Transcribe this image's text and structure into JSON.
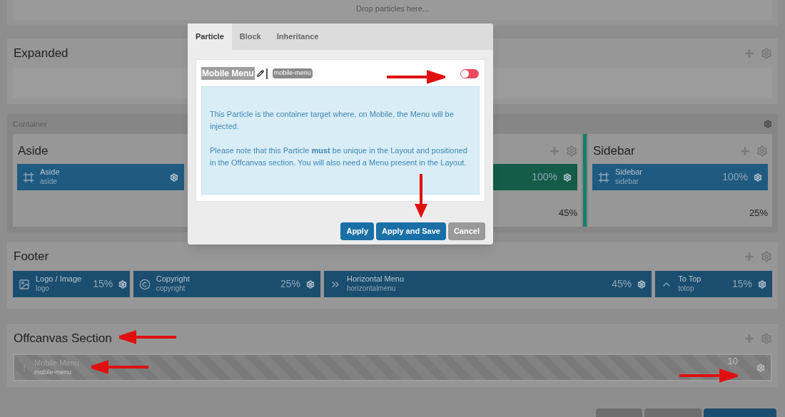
{
  "drop_zone": {
    "text": "Drop particles here..."
  },
  "expanded": {
    "title": "Expanded"
  },
  "container": {
    "label": "Container",
    "columns": [
      {
        "title": "Aside",
        "particle": {
          "title": "Aside",
          "subtitle": "aside",
          "color": "#1f5a80"
        }
      },
      {
        "size": "45%",
        "particle": {
          "size": "100%",
          "color": "#145c48"
        }
      },
      {
        "title": "Sidebar",
        "size": "25%",
        "particle": {
          "title": "Sidebar",
          "subtitle": "sidebar",
          "size": "100%",
          "color": "#1f5a80"
        }
      }
    ]
  },
  "footer": {
    "title": "Footer",
    "particles": [
      {
        "kind": "image",
        "title": "Logo / Image",
        "subtitle": "logo",
        "size": "15%"
      },
      {
        "kind": "copyright",
        "title": "Copyright",
        "subtitle": "copyright",
        "size": "25%"
      },
      {
        "kind": "menu",
        "title": "Horizontal Menu",
        "subtitle": "horizontalmenu",
        "size": "45%"
      },
      {
        "kind": "totop",
        "title": "To Top",
        "subtitle": "totop",
        "size": "15%"
      }
    ]
  },
  "offcanvas": {
    "title": "Offcanvas Section",
    "particle": {
      "title": "Mobile Menu",
      "subtitle": "mobile-menu",
      "size": "10",
      "disabled": true
    }
  },
  "modal": {
    "tabs": [
      {
        "label": "Particle",
        "selected": true
      },
      {
        "label": "Block",
        "selected": false
      },
      {
        "label": "Inheritance",
        "selected": false
      }
    ],
    "title": "Mobile Menu",
    "badge": "mobile-menu",
    "enabled": false,
    "paragraphs": [
      "This Particle is the container target where, on Mobile, the Menu will be injected.",
      "Please note that this Particle **must** be unique in the Layout and positioned in the Offcanvas section. You will also need a Menu present in the Layout."
    ],
    "buttons": [
      {
        "label": "Apply",
        "kind": "primary"
      },
      {
        "label": "Apply and Save",
        "kind": "primary"
      },
      {
        "label": "Cancel",
        "kind": "secondary"
      }
    ]
  }
}
